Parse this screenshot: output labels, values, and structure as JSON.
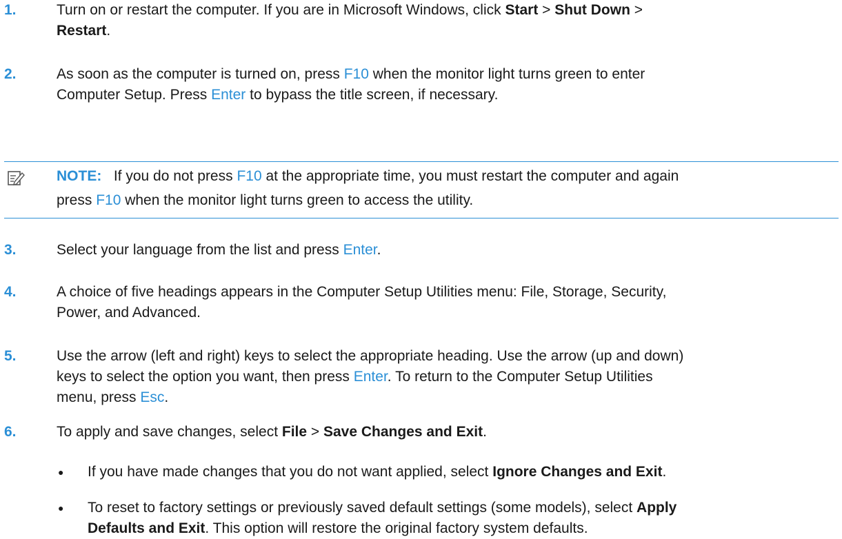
{
  "steps": [
    {
      "num": "1.",
      "parts": [
        {
          "t": "Turn on or restart the computer. If you are in Microsoft Windows, click "
        },
        {
          "t": "Start",
          "b": true
        },
        {
          "t": " > "
        },
        {
          "t": "Shut Down",
          "b": true
        },
        {
          "t": " > "
        }
      ],
      "line2": [
        {
          "t": "Restart",
          "b": true
        },
        {
          "t": "."
        }
      ]
    },
    {
      "num": "2.",
      "parts": [
        {
          "t": "As soon as the computer is turned on, press "
        },
        {
          "t": "F10",
          "k": true
        },
        {
          "t": " when the monitor light turns green to enter"
        }
      ],
      "line2": [
        {
          "t": "Computer Setup. Press "
        },
        {
          "t": "Enter",
          "k": true
        },
        {
          "t": " to bypass the title screen, if necessary."
        }
      ]
    },
    {
      "num": "3.",
      "parts": [
        {
          "t": "Select your language from the list and press "
        },
        {
          "t": "Enter",
          "k": true
        },
        {
          "t": "."
        }
      ]
    },
    {
      "num": "4.",
      "parts": [
        {
          "t": "A choice of five headings appears in the Computer Setup Utilities menu: File, Storage, Security,"
        }
      ],
      "line2": [
        {
          "t": "Power, and Advanced."
        }
      ]
    },
    {
      "num": "5.",
      "parts": [
        {
          "t": "Use the arrow (left and right) keys to select the appropriate heading. Use the arrow (up and down)"
        }
      ],
      "line2": [
        {
          "t": "keys to select the option you want, then press "
        },
        {
          "t": "Enter",
          "k": true
        },
        {
          "t": ". To return to the Computer Setup Utilities"
        }
      ],
      "line3": [
        {
          "t": "menu, press "
        },
        {
          "t": "Esc",
          "k": true
        },
        {
          "t": "."
        }
      ]
    },
    {
      "num": "6.",
      "parts": [
        {
          "t": "To apply and save changes, select "
        },
        {
          "t": "File",
          "b": true
        },
        {
          "t": " > "
        },
        {
          "t": "Save Changes and Exit",
          "b": true
        },
        {
          "t": "."
        }
      ]
    }
  ],
  "note": {
    "label": "NOTE:",
    "line1": [
      {
        "t": "If you do not press "
      },
      {
        "t": "F10",
        "k": true
      },
      {
        "t": " at the appropriate time, you must restart the computer and again"
      }
    ],
    "line2": [
      {
        "t": "press "
      },
      {
        "t": "F10",
        "k": true
      },
      {
        "t": " when the monitor light turns green to access the utility."
      }
    ]
  },
  "bullets": [
    {
      "bullet": "●",
      "line1": [
        {
          "t": "If you have made changes that you do not want applied, select "
        },
        {
          "t": "Ignore Changes and Exit",
          "b": true
        },
        {
          "t": "."
        }
      ]
    },
    {
      "bullet": "●",
      "line1": [
        {
          "t": "To reset to factory settings or previously saved default settings (some models), select "
        },
        {
          "t": "Apply",
          "b": true
        }
      ],
      "line2": [
        {
          "t": "Defaults and Exit",
          "b": true
        },
        {
          "t": ". This option will restore the original factory system defaults."
        }
      ]
    }
  ]
}
